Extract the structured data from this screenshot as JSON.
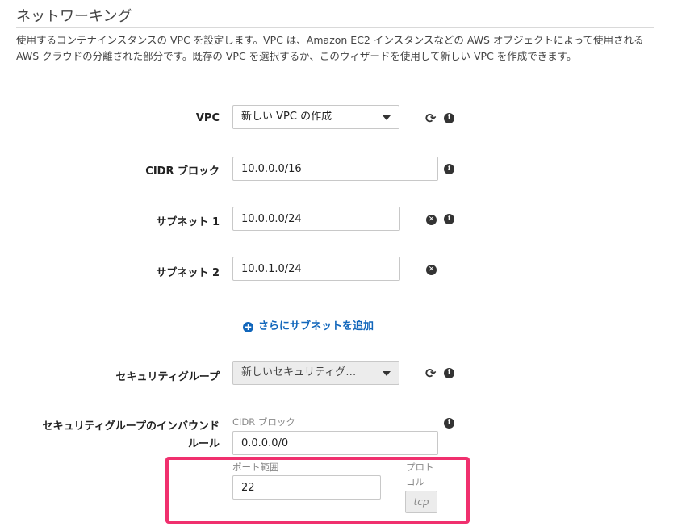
{
  "section": {
    "title": "ネットワーキング",
    "description": "使用するコンテナインスタンスの VPC を設定します。VPC は、Amazon EC2 インスタンスなどの AWS オブジェクトによって使用される AWS クラウドの分離された部分です。既存の VPC を選択するか、このウィザードを使用して新しい VPC を作成できます。"
  },
  "vpc": {
    "label": "VPC",
    "selected": "新しい VPC の作成"
  },
  "cidr": {
    "label": "CIDR ブロック",
    "value": "10.0.0.0/16"
  },
  "subnet1": {
    "label": "サブネット 1",
    "value": "10.0.0.0/24"
  },
  "subnet2": {
    "label": "サブネット 2",
    "value": "10.0.1.0/24"
  },
  "add_subnet": {
    "label": "さらにサブネットを追加"
  },
  "security_group": {
    "label": "セキュリティグループ",
    "selected": "新しいセキュリティグ…"
  },
  "inbound": {
    "label_line1": "セキュリティグループのインバウンド",
    "label_line2": "ルール",
    "cidr_label": "CIDR ブロック",
    "cidr_value": "0.0.0.0/0",
    "port_label": "ポート範囲",
    "port_value": "22",
    "protocol_label_line1": "プロト",
    "protocol_label_line2": "コル",
    "protocol_value": "tcp"
  },
  "icons": {
    "info": "info-icon",
    "refresh": "refresh-icon",
    "remove": "remove-icon",
    "add": "plus-circle-icon"
  },
  "colors": {
    "link": "#1166bb",
    "highlight": "#f0306e"
  }
}
